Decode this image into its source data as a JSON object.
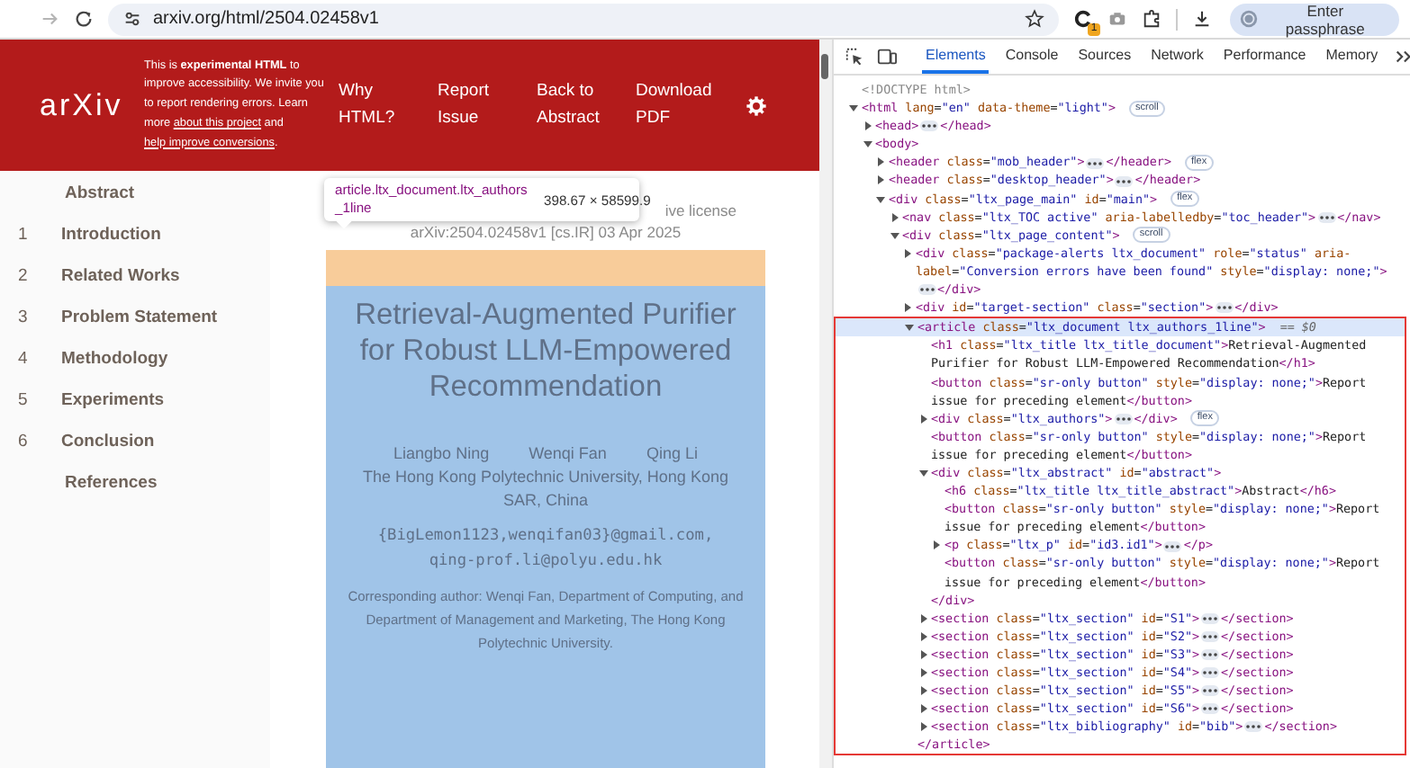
{
  "browser": {
    "url": "arxiv.org/html/2504.02458v1",
    "extension_badge": "1",
    "passphrase_button": "Enter passphrase"
  },
  "header": {
    "logo": "arXiv",
    "notice": [
      {
        "kind": "text",
        "text": "This is **experimental HTML** to improve accessibility. We invite you to report rendering errors. Learn more "
      },
      {
        "kind": "link",
        "text": "about this project"
      },
      {
        "kind": "text",
        "text": " and "
      },
      {
        "kind": "link",
        "text": "help improve conversions"
      },
      {
        "kind": "text",
        "text": "."
      }
    ],
    "nav": [
      "Why HTML?",
      "Report Issue",
      "Back to Abstract",
      "Download PDF"
    ]
  },
  "toc": [
    {
      "label": "Abstract"
    },
    {
      "number": "1",
      "label": "Introduction"
    },
    {
      "number": "2",
      "label": "Related Works"
    },
    {
      "number": "3",
      "label": "Problem Statement"
    },
    {
      "number": "4",
      "label": "Methodology"
    },
    {
      "number": "5",
      "label": "Experiments"
    },
    {
      "number": "6",
      "label": "Conclusion"
    },
    {
      "label": "References"
    }
  ],
  "page": {
    "license_fragment": "ive license",
    "arxiv_id": "arXiv:2504.02458v1 [cs.IR] 03 Apr 2025",
    "title": "Retrieval-Augmented Purifier for Robust LLM-Empowered Recommendation",
    "authors": [
      "Liangbo Ning",
      "Wenqi Fan",
      "Qing Li"
    ],
    "affiliation": "The Hong Kong Polytechnic University, Hong Kong SAR, China",
    "emails": [
      "{BigLemon1123,wenqifan03}@gmail.com,",
      "qing-prof.li@polyu.edu.hk"
    ],
    "note": "Corresponding author: Wenqi Fan, Department of Computing, and Department of Management and Marketing, The Hong Kong Polytechnic University."
  },
  "inspect_tooltip": {
    "selector": "article.ltx_document.ltx_authors_1line",
    "size": "398.67 × 58599.9"
  },
  "devtools": {
    "tabs": [
      {
        "label": "Elements",
        "selected": true
      },
      {
        "label": "Console",
        "selected": false
      },
      {
        "label": "Sources",
        "selected": false
      },
      {
        "label": "Network",
        "selected": false
      },
      {
        "label": "Performance",
        "selected": false
      },
      {
        "label": "Memory",
        "selected": false
      }
    ],
    "dom": [
      {
        "kind": "doctype",
        "open": "<!DOCTYPE html>",
        "selected": false
      },
      {
        "kind": "element",
        "open": "<html lang=\"en\" data-theme=\"light\">",
        "badge": "scroll",
        "expanded": true,
        "selected": false,
        "children": [
          {
            "kind": "element",
            "open": "<head>",
            "close": "</head>",
            "expanded": false,
            "selected": false
          },
          {
            "kind": "element",
            "open": "<body>",
            "expanded": true,
            "selected": false,
            "children": [
              {
                "kind": "element",
                "open": "<header class=\"mob_header\">",
                "close": "</header>",
                "badge": "flex",
                "expanded": false,
                "selected": false
              },
              {
                "kind": "element",
                "open": "<header class=\"desktop_header\">",
                "close": "</header>",
                "expanded": false,
                "selected": false
              },
              {
                "kind": "element",
                "open": "<div class=\"ltx_page_main\" id=\"main\">",
                "badge": "flex",
                "expanded": true,
                "selected": false,
                "children": [
                  {
                    "kind": "element",
                    "open": "<nav class=\"ltx_TOC active\" aria-labelledby=\"toc_header\">",
                    "close": "</nav>",
                    "expanded": false,
                    "selected": false
                  },
                  {
                    "kind": "element",
                    "open": "<div class=\"ltx_page_content\">",
                    "badge": "scroll",
                    "expanded": true,
                    "selected": false,
                    "children": [
                      {
                        "kind": "element",
                        "open": "<div class=\"package-alerts ltx_document\" role=\"status\" aria-label=\"Conversion errors have been found\" style=\"display: none;\">",
                        "close": "</div>",
                        "expanded": false,
                        "selected": false
                      },
                      {
                        "kind": "element",
                        "open": "<div id=\"target-section\" class=\"section\">",
                        "close": "</div>",
                        "expanded": false,
                        "selected": false
                      },
                      {
                        "kind": "element",
                        "open": "<article class=\"ltx_document ltx_authors_1line\">",
                        "marker": "== $0",
                        "close": "</article>",
                        "expanded": true,
                        "selected": true,
                        "children": [
                          {
                            "kind": "element",
                            "open": "<h1 class=\"ltx_title ltx_title_document\">",
                            "content": "Retrieval-Augmented Purifier for Robust LLM-Empowered Recommendation",
                            "close": "</h1>",
                            "selected": false
                          },
                          {
                            "kind": "element",
                            "open": "<button class=\"sr-only button\" style=\"display: none;\">",
                            "content": "Report issue for preceding element",
                            "close": "</button>",
                            "selected": false
                          },
                          {
                            "kind": "element",
                            "open": "<div class=\"ltx_authors\">",
                            "close": "</div>",
                            "badge": "flex",
                            "expanded": false,
                            "selected": false
                          },
                          {
                            "kind": "element",
                            "open": "<button class=\"sr-only button\" style=\"display: none;\">",
                            "content": "Report issue for preceding element",
                            "close": "</button>",
                            "selected": false
                          },
                          {
                            "kind": "element",
                            "open": "<div class=\"ltx_abstract\" id=\"abstract\">",
                            "close": "</div>",
                            "expanded": true,
                            "selected": false,
                            "children": [
                              {
                                "kind": "element",
                                "open": "<h6 class=\"ltx_title ltx_title_abstract\">",
                                "content": "Abstract",
                                "close": "</h6>",
                                "selected": false
                              },
                              {
                                "kind": "element",
                                "open": "<button class=\"sr-only button\" style=\"display: none;\">",
                                "content": "Report issue for preceding element",
                                "close": "</button>",
                                "selected": false
                              },
                              {
                                "kind": "element",
                                "open": "<p class=\"ltx_p\" id=\"id3.id1\">",
                                "close": "</p>",
                                "expanded": false,
                                "selected": false
                              },
                              {
                                "kind": "element",
                                "open": "<button class=\"sr-only button\" style=\"display: none;\">",
                                "content": "Report issue for preceding element",
                                "close": "</button>",
                                "selected": false
                              }
                            ]
                          },
                          {
                            "kind": "element",
                            "open": "<section class=\"ltx_section\" id=\"S1\">",
                            "close": "</section>",
                            "expanded": false,
                            "selected": false
                          },
                          {
                            "kind": "element",
                            "open": "<section class=\"ltx_section\" id=\"S2\">",
                            "close": "</section>",
                            "expanded": false,
                            "selected": false
                          },
                          {
                            "kind": "element",
                            "open": "<section class=\"ltx_section\" id=\"S3\">",
                            "close": "</section>",
                            "expanded": false,
                            "selected": false
                          },
                          {
                            "kind": "element",
                            "open": "<section class=\"ltx_section\" id=\"S4\">",
                            "close": "</section>",
                            "expanded": false,
                            "selected": false
                          },
                          {
                            "kind": "element",
                            "open": "<section class=\"ltx_section\" id=\"S5\">",
                            "close": "</section>",
                            "expanded": false,
                            "selected": false
                          },
                          {
                            "kind": "element",
                            "open": "<section class=\"ltx_section\" id=\"S6\">",
                            "close": "</section>",
                            "expanded": false,
                            "selected": false
                          },
                          {
                            "kind": "element",
                            "open": "<section class=\"ltx_bibliography\" id=\"bib\">",
                            "close": "</section>",
                            "expanded": false,
                            "selected": false
                          }
                        ]
                      }
                    ]
                  }
                ]
              }
            ]
          }
        ]
      }
    ]
  }
}
